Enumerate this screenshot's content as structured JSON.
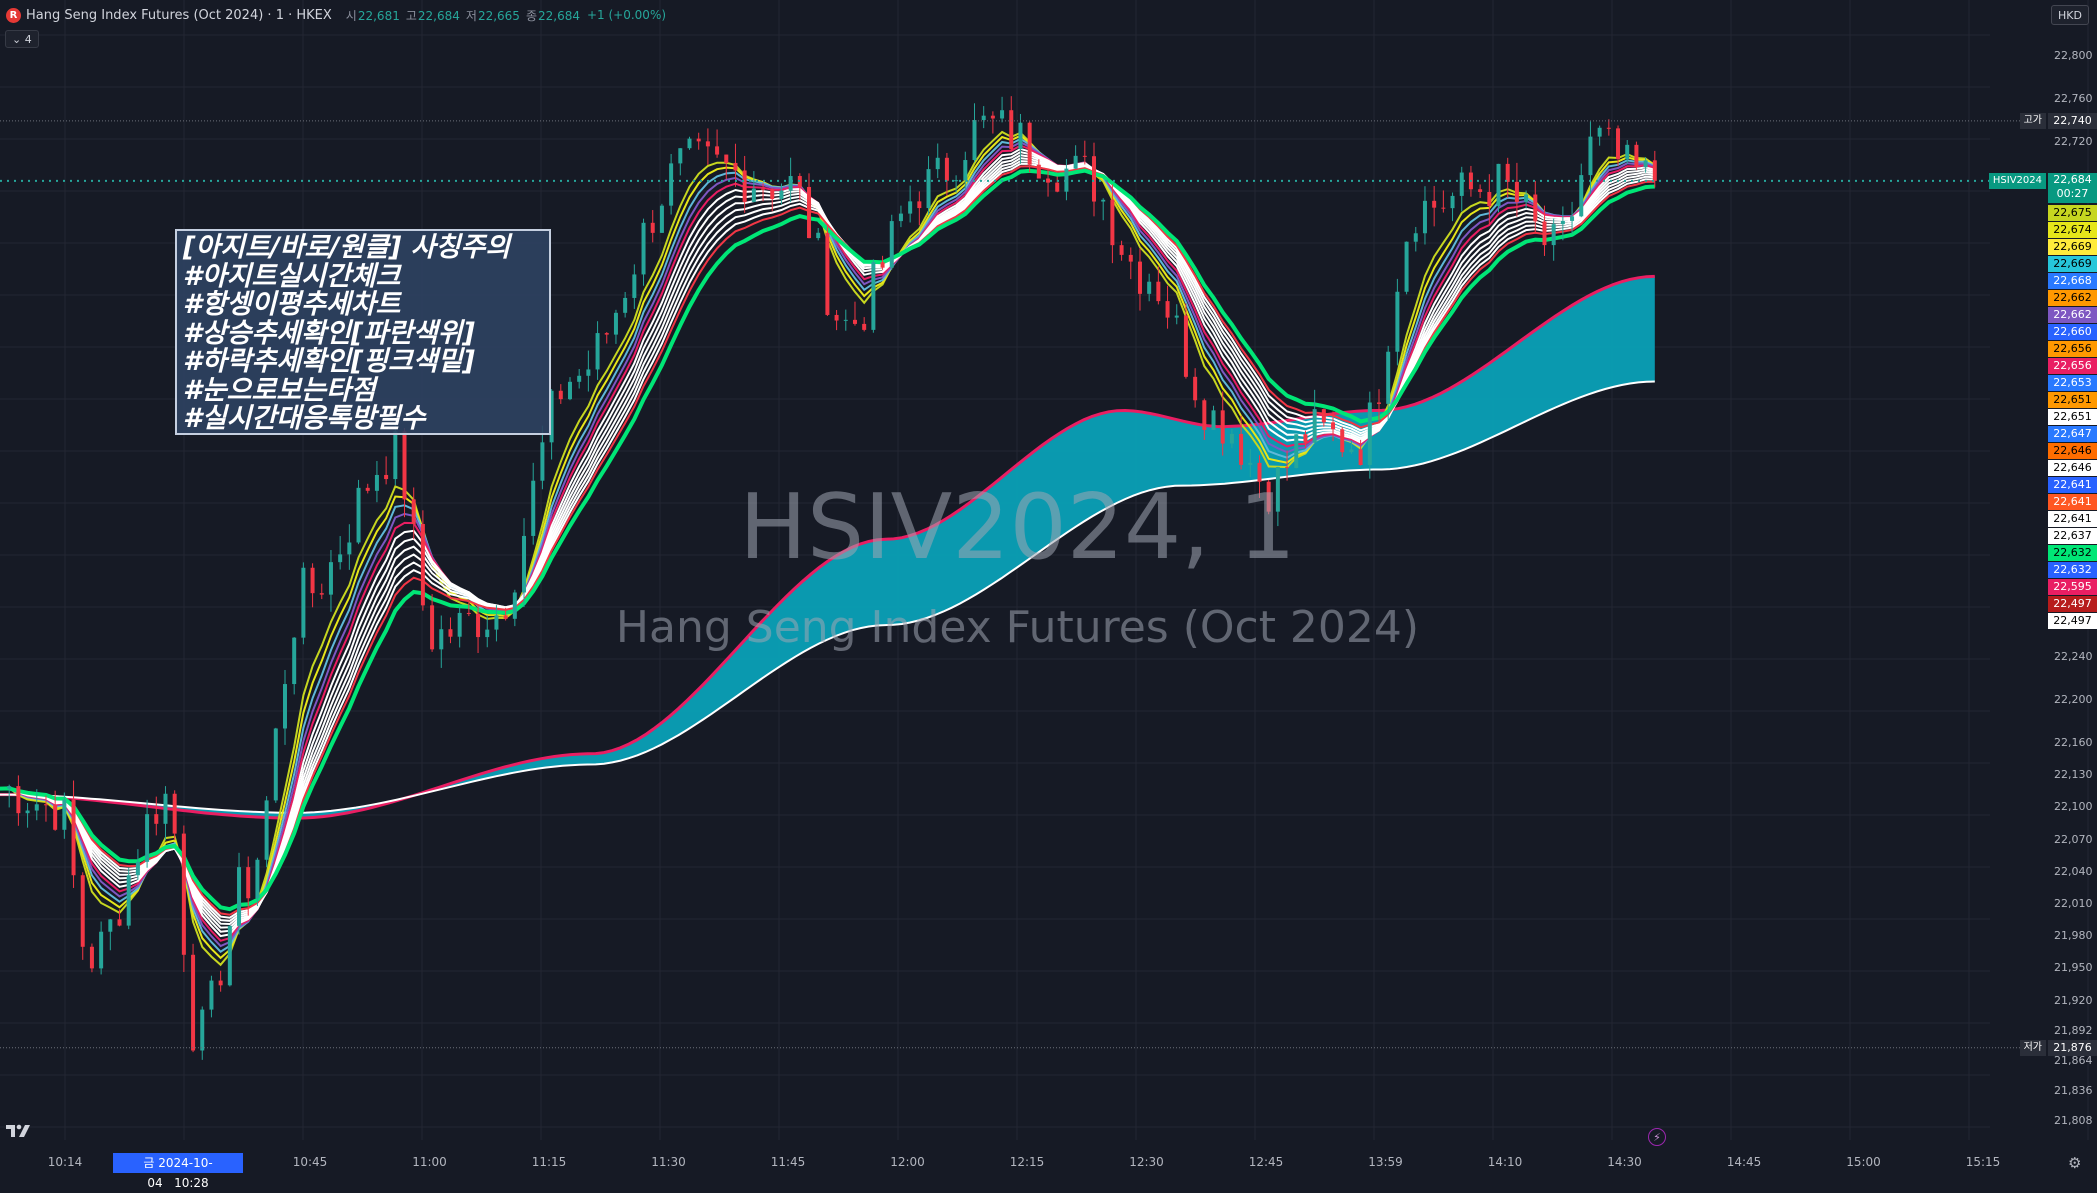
{
  "header": {
    "logo_letter": "R",
    "title": "Hang Seng Index Futures (Oct 2024) · 1 · HKEX",
    "open_label": "시",
    "open_value": "22,681",
    "high_label": "고",
    "high_value": "22,684",
    "low_label": "저",
    "low_value": "22,665",
    "close_label": "종",
    "close_value": "22,684",
    "change": "+1 (+0.00%)"
  },
  "indicator_toggle": "4",
  "currency": "HKD",
  "annotation_lines": [
    "[아지트/바로/원클] 사칭주의",
    "#아지트실시간체크",
    "#항셍이평추세차트",
    "#상승추세확인[파란색위]",
    "#하락추세확인[핑크색밑]",
    "#눈으로보는타점",
    "#실시간대응톡방필수"
  ],
  "watermark": {
    "symbol": "HSIV2024, 1",
    "name": "Hang Seng Index Futures (Oct 2024)"
  },
  "y_axis_ticks": [
    "22,800",
    "22,760",
    "22,720",
    "22,240",
    "22,200",
    "22,160",
    "22,130",
    "22,100",
    "22,070",
    "22,040",
    "22,010",
    "21,980",
    "21,950",
    "21,920",
    "21,892",
    "21,864",
    "21,836",
    "21,808"
  ],
  "high_marker": {
    "label": "고가",
    "value": "22,740"
  },
  "low_marker": {
    "label": "저가",
    "value": "21,876"
  },
  "last_price": {
    "symbol": "HSIV2024",
    "value": "22,684",
    "countdown": "00:27"
  },
  "ma_price_labels": [
    {
      "value": "22,675",
      "color": "#c6d620",
      "text_color": "#000000"
    },
    {
      "value": "22,674",
      "color": "#e6e61a",
      "text_color": "#000000"
    },
    {
      "value": "22,669",
      "color": "#ffeb3b",
      "text_color": "#000000"
    },
    {
      "value": "22,669",
      "color": "#26c6da",
      "text_color": "#000000"
    },
    {
      "value": "22,668",
      "color": "#2979ff",
      "text_color": "#ffffff"
    },
    {
      "value": "22,662",
      "color": "#ff9800",
      "text_color": "#000000"
    },
    {
      "value": "22,662",
      "color": "#7e57c2",
      "text_color": "#ffffff"
    },
    {
      "value": "22,660",
      "color": "#2962ff",
      "text_color": "#ffffff"
    },
    {
      "value": "22,656",
      "color": "#ff9800",
      "text_color": "#000000"
    },
    {
      "value": "22,656",
      "color": "#e91e63",
      "text_color": "#ffffff"
    },
    {
      "value": "22,653",
      "color": "#2979ff",
      "text_color": "#ffffff"
    },
    {
      "value": "22,651",
      "color": "#ff9800",
      "text_color": "#000000"
    },
    {
      "value": "22,651",
      "color": "#ffffff",
      "text_color": "#000000"
    },
    {
      "value": "22,647",
      "color": "#2979ff",
      "text_color": "#ffffff"
    },
    {
      "value": "22,646",
      "color": "#ff6d00",
      "text_color": "#000000"
    },
    {
      "value": "22,646",
      "color": "#ffffff",
      "text_color": "#000000"
    },
    {
      "value": "22,641",
      "color": "#2962ff",
      "text_color": "#ffffff"
    },
    {
      "value": "22,641",
      "color": "#ff5722",
      "text_color": "#ffffff"
    },
    {
      "value": "22,641",
      "color": "#ffffff",
      "text_color": "#000000"
    },
    {
      "value": "22,637",
      "color": "#ffffff",
      "text_color": "#000000"
    },
    {
      "value": "22,632",
      "color": "#00e676",
      "text_color": "#000000"
    },
    {
      "value": "22,632",
      "color": "#2962ff",
      "text_color": "#ffffff"
    },
    {
      "value": "22,595",
      "color": "#e91e63",
      "text_color": "#ffffff"
    },
    {
      "value": "22,497",
      "color": "#b71c1c",
      "text_color": "#ffffff"
    },
    {
      "value": "22,497",
      "color": "#ffffff",
      "text_color": "#000000"
    }
  ],
  "x_axis_ticks": [
    "10:14",
    "10:45",
    "11:00",
    "11:15",
    "11:30",
    "11:45",
    "12:00",
    "12:15",
    "12:30",
    "12:45",
    "13:59",
    "14:10",
    "14:30",
    "14:45",
    "15:00",
    "15:15"
  ],
  "crosshair_date": {
    "day": "금",
    "date": "2024-10-04",
    "time": "10:28"
  },
  "colors": {
    "up": "#26a69a",
    "down": "#f23645",
    "background": "#161a25",
    "ribbon_fill": "#0aa0b6",
    "ribbon_top": "#e91e63",
    "ribbon_bottom": "#ffffff",
    "grid": "#232632"
  },
  "icons": [
    "tradingview-logo-icon",
    "lightning-icon",
    "settings-gear-icon",
    "chevron-down-icon"
  ],
  "chart_data": {
    "type": "candlestick",
    "title": "Hang Seng Index Futures (Oct 2024) · 1 · HKEX",
    "timeframe": "1 minute",
    "xlabel": "",
    "ylabel": "",
    "ylim": [
      21790,
      22820
    ],
    "grid": true,
    "price_anchors": [
      {
        "x": 0.0,
        "p": 22118
      },
      {
        "x": 0.03,
        "p": 22100
      },
      {
        "x": 0.045,
        "p": 21960
      },
      {
        "x": 0.085,
        "p": 22110
      },
      {
        "x": 0.1,
        "p": 21885
      },
      {
        "x": 0.125,
        "p": 22030
      },
      {
        "x": 0.155,
        "p": 22300
      },
      {
        "x": 0.2,
        "p": 22430
      },
      {
        "x": 0.22,
        "p": 22260
      },
      {
        "x": 0.25,
        "p": 22280
      },
      {
        "x": 0.29,
        "p": 22500
      },
      {
        "x": 0.35,
        "p": 22700
      },
      {
        "x": 0.4,
        "p": 22680
      },
      {
        "x": 0.43,
        "p": 22550
      },
      {
        "x": 0.47,
        "p": 22680
      },
      {
        "x": 0.5,
        "p": 22735
      },
      {
        "x": 0.55,
        "p": 22690
      },
      {
        "x": 0.58,
        "p": 22600
      },
      {
        "x": 0.62,
        "p": 22460
      },
      {
        "x": 0.645,
        "p": 22400
      },
      {
        "x": 0.665,
        "p": 22450
      },
      {
        "x": 0.69,
        "p": 22440
      },
      {
        "x": 0.72,
        "p": 22660
      },
      {
        "x": 0.76,
        "p": 22680
      },
      {
        "x": 0.79,
        "p": 22620
      },
      {
        "x": 0.81,
        "p": 22720
      },
      {
        "x": 0.83,
        "p": 22690
      },
      {
        "x": 0.84,
        "p": 22684
      }
    ],
    "ma_bands": {
      "fast_start": 22118,
      "offsets_at_peak": [
        0,
        -10,
        -20,
        -30,
        -40,
        -50,
        -60,
        -70,
        -80,
        -90,
        -100,
        -110,
        -120
      ]
    },
    "ribbon": {
      "top_anchors": [
        {
          "x": 0.0,
          "p": 22112
        },
        {
          "x": 0.15,
          "p": 22090
        },
        {
          "x": 0.3,
          "p": 22150
        },
        {
          "x": 0.45,
          "p": 22350
        },
        {
          "x": 0.57,
          "p": 22470
        },
        {
          "x": 0.62,
          "p": 22455
        },
        {
          "x": 0.7,
          "p": 22470
        },
        {
          "x": 0.84,
          "p": 22595
        }
      ],
      "bottom_anchors": [
        {
          "x": 0.0,
          "p": 22112
        },
        {
          "x": 0.15,
          "p": 22095
        },
        {
          "x": 0.3,
          "p": 22140
        },
        {
          "x": 0.45,
          "p": 22270
        },
        {
          "x": 0.6,
          "p": 22400
        },
        {
          "x": 0.7,
          "p": 22415
        },
        {
          "x": 0.84,
          "p": 22497
        }
      ]
    },
    "last_value": 22684,
    "session_high": 22740,
    "session_low": 21876
  }
}
